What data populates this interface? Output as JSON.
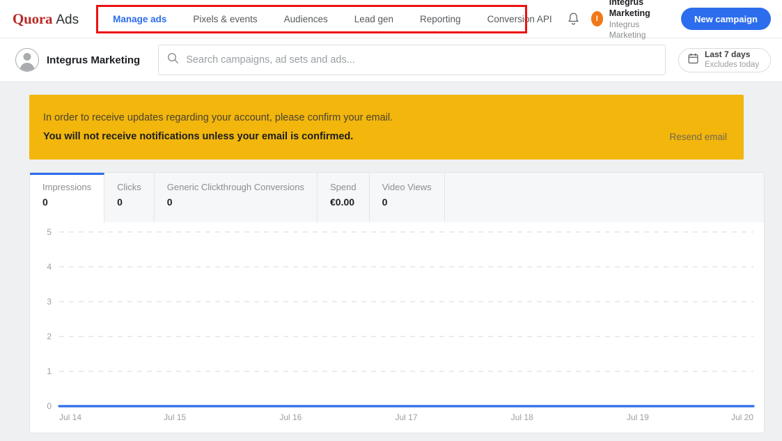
{
  "header": {
    "brand_primary": "Quora",
    "brand_secondary": "Ads",
    "nav": [
      {
        "label": "Manage ads",
        "active": true
      },
      {
        "label": "Pixels & events",
        "active": false
      },
      {
        "label": "Audiences",
        "active": false
      },
      {
        "label": "Lead gen",
        "active": false
      },
      {
        "label": "Reporting",
        "active": false
      },
      {
        "label": "Conversion API",
        "active": false
      }
    ],
    "bell_icon": "notification-bell-icon",
    "account": {
      "avatar_initial": "I",
      "avatar_color": "#f07818",
      "name": "Integrus Marketing",
      "subtitle": "Integrus Marketing"
    },
    "new_campaign_label": "New campaign",
    "accent_color": "#2b6dec",
    "brand_color": "#b92b27",
    "annotation_box_color": "#ee1111"
  },
  "search_row": {
    "profile_name": "Integrus Marketing",
    "profile_avatar_icon": "user-avatar-icon",
    "search_icon": "search-icon",
    "search_value": "",
    "search_placeholder": "Search campaigns, ad sets and ads...",
    "date_range": {
      "calendar_icon": "calendar-icon",
      "main": "Last 7 days",
      "sub": "Excludes today"
    }
  },
  "banner": {
    "background_color": "#f2b60d",
    "line1": "In order to receive updates regarding your account, please confirm your email.",
    "line2": "You will not receive notifications unless your email is confirmed.",
    "action_label": "Resend email"
  },
  "metrics": [
    {
      "label": "Impressions",
      "value": "0",
      "active": true
    },
    {
      "label": "Clicks",
      "value": "0",
      "active": false
    },
    {
      "label": "Generic Clickthrough Conversions",
      "value": "0",
      "active": false
    },
    {
      "label": "Spend",
      "value": "€0.00",
      "active": false
    },
    {
      "label": "Video Views",
      "value": "0",
      "active": false
    }
  ],
  "chart_data": {
    "type": "line",
    "title": "",
    "xlabel": "",
    "ylabel": "",
    "x": [
      "Jul 14",
      "Jul 15",
      "Jul 16",
      "Jul 17",
      "Jul 18",
      "Jul 19",
      "Jul 20"
    ],
    "series": [
      {
        "name": "Impressions",
        "values": [
          0,
          0,
          0,
          0,
          0,
          0,
          0
        ],
        "color": "#2b6dec"
      }
    ],
    "yticks": [
      0,
      1,
      2,
      3,
      4,
      5
    ],
    "ylim": [
      0,
      5
    ],
    "grid": true,
    "grid_style": "dashed",
    "grid_color": "#e3e5e6",
    "legend": "none",
    "tick_color": "#9a9ea1"
  }
}
